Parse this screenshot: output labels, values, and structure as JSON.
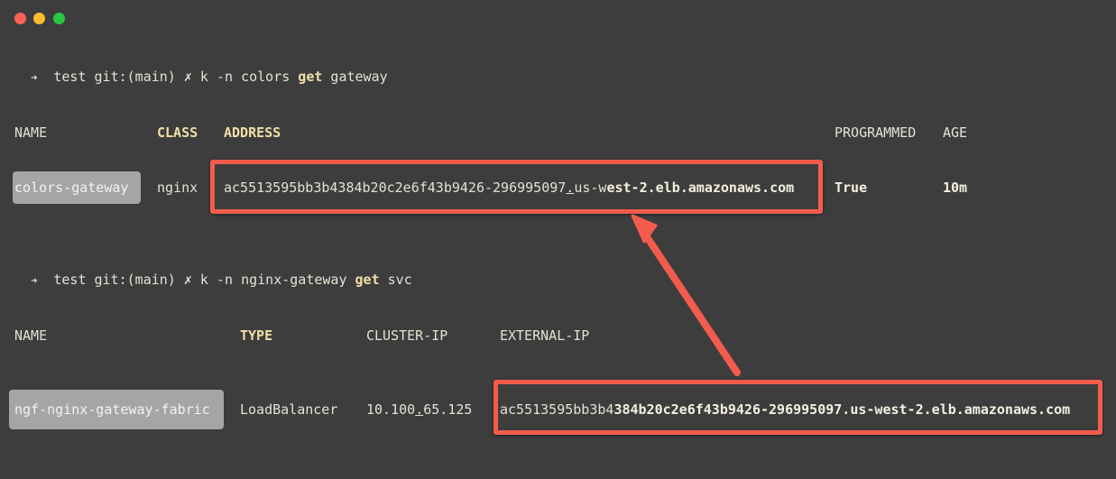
{
  "window": {
    "controls": [
      {
        "name": "close",
        "color": "#fe5f57"
      },
      {
        "name": "minimize",
        "color": "#febc2e"
      },
      {
        "name": "zoom",
        "color": "#28c840"
      }
    ]
  },
  "prompt1": {
    "arrow": "➜",
    "dir": "test",
    "git": "git:(main)",
    "dirty": "✗",
    "cmd_pre": "k -n colors",
    "cmd_verb": "get",
    "cmd_post": "gateway"
  },
  "gateway_table": {
    "headers": {
      "name": "NAME",
      "class": "CLASS",
      "address": "ADDRESS",
      "programmed": "PROGRAMMED",
      "age": "AGE"
    },
    "row": {
      "name": "colors-gateway",
      "class": "nginx",
      "address_plain": "ac5513595bb3b4384b20c2e6f43b9426-296995097",
      "address_dot": ".",
      "address_mid": "us-w",
      "address_bold": "est-2.elb.amazonaws.com",
      "programmed": "True",
      "age": "10m"
    }
  },
  "prompt2": {
    "arrow": "➜",
    "dir": "test",
    "git": "git:(main)",
    "dirty": "✗",
    "cmd_pre": "k -n nginx-gateway",
    "cmd_verb": "get",
    "cmd_post": "svc"
  },
  "svc_table": {
    "headers": {
      "name": "NAME",
      "type": "TYPE",
      "cluster_ip": "CLUSTER-IP",
      "external_ip": "EXTERNAL-IP"
    },
    "row": {
      "name": "ngf-nginx-gateway-fabric",
      "type": "LoadBalancer",
      "cluster_ip_a": "10.100",
      "cluster_ip_dot": ".",
      "cluster_ip_b": "65.125",
      "external_ip_plain": "ac5513595bb3b4",
      "external_ip_bold": "384b20c2e6f43b9426-296995097.us-west-2.elb.amazonaws.com"
    }
  },
  "annotation": {
    "color": "#f35c4c",
    "label": "arrow linking matching addresses"
  }
}
